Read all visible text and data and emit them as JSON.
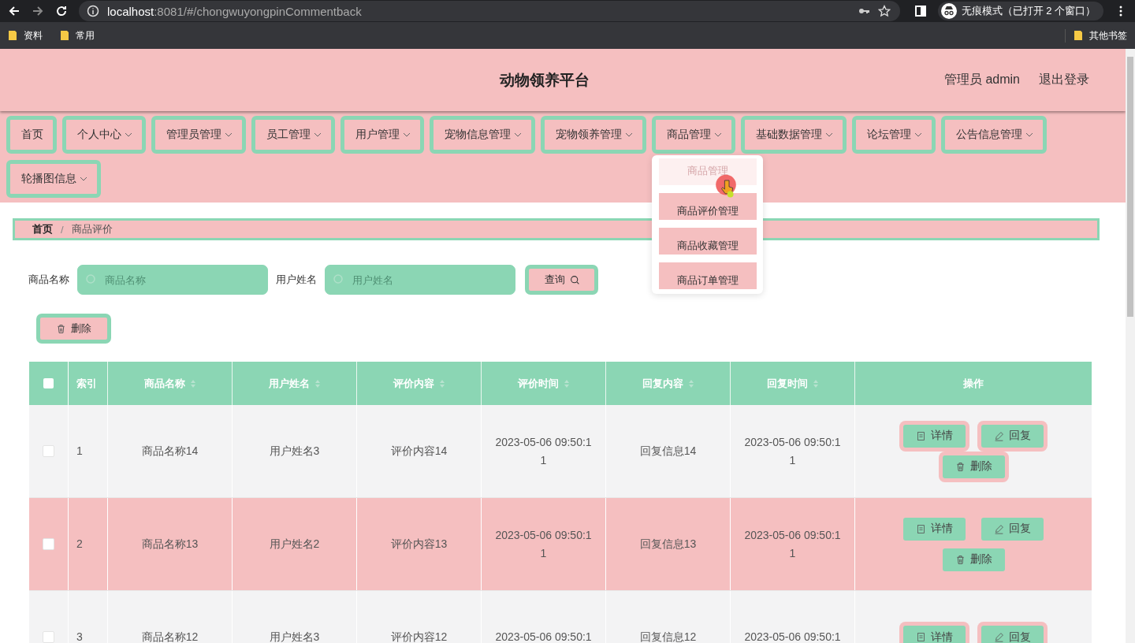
{
  "browser": {
    "url_host": "localhost",
    "url_rest": ":8081/#/chongwuyongpinCommentback",
    "incognito": "无痕模式（已打开 2 个窗口）",
    "bookmarks": [
      "资料",
      "常用"
    ],
    "other_bookmarks": "其他书签"
  },
  "header": {
    "title": "动物领养平台",
    "user": "管理员 admin",
    "logout": "退出登录"
  },
  "nav": [
    {
      "label": "首页",
      "has_menu": false
    },
    {
      "label": "个人中心",
      "has_menu": true
    },
    {
      "label": "管理员管理",
      "has_menu": true
    },
    {
      "label": "员工管理",
      "has_menu": true
    },
    {
      "label": "用户管理",
      "has_menu": true
    },
    {
      "label": "宠物信息管理",
      "has_menu": true
    },
    {
      "label": "宠物领养管理",
      "has_menu": true
    },
    {
      "label": "商品管理",
      "has_menu": true,
      "expanded": true,
      "menu": [
        {
          "label": "商品管理",
          "dimmed": true
        },
        {
          "label": "商品评价管理",
          "dimmed": false
        },
        {
          "label": "商品收藏管理",
          "dimmed": false
        },
        {
          "label": "商品订单管理",
          "dimmed": false
        }
      ]
    },
    {
      "label": "基础数据管理",
      "has_menu": true
    },
    {
      "label": "论坛管理",
      "has_menu": true
    },
    {
      "label": "公告信息管理",
      "has_menu": true
    },
    {
      "label": "轮播图信息",
      "has_menu": true
    }
  ],
  "breadcrumb": [
    "首页",
    "商品评价"
  ],
  "breadcrumb_separator": "/",
  "search": {
    "fields": [
      {
        "label": "商品名称",
        "placeholder": "商品名称"
      },
      {
        "label": "用户姓名",
        "placeholder": "用户姓名"
      }
    ],
    "button": "查询"
  },
  "toolbar": {
    "delete": "删除"
  },
  "table": {
    "header_checked": false,
    "columns": [
      {
        "label": "索引",
        "sortable": false
      },
      {
        "label": "商品名称",
        "sortable": true
      },
      {
        "label": "用户姓名",
        "sortable": true
      },
      {
        "label": "评价内容",
        "sortable": true
      },
      {
        "label": "评价时间",
        "sortable": true
      },
      {
        "label": "回复内容",
        "sortable": true
      },
      {
        "label": "回复时间",
        "sortable": true
      },
      {
        "label": "操作",
        "sortable": false
      }
    ],
    "rows": [
      {
        "checked": false,
        "highlighted": false,
        "cells": [
          "1",
          "商品名称14",
          "用户姓名3",
          "评价内容14",
          "2023-05-06 09:50:11",
          "回复信息14",
          "2023-05-06 09:50:11"
        ],
        "actions": [
          {
            "kind": "detail",
            "label": "详情"
          },
          {
            "kind": "reply",
            "label": "回复"
          },
          {
            "kind": "delete",
            "label": "删除"
          }
        ]
      },
      {
        "checked": false,
        "highlighted": true,
        "cells": [
          "2",
          "商品名称13",
          "用户姓名2",
          "评价内容13",
          "2023-05-06 09:50:11",
          "回复信息13",
          "2023-05-06 09:50:11"
        ],
        "actions": [
          {
            "kind": "detail",
            "label": "详情"
          },
          {
            "kind": "reply",
            "label": "回复"
          },
          {
            "kind": "delete",
            "label": "删除"
          }
        ]
      },
      {
        "checked": false,
        "highlighted": false,
        "cells": [
          "3",
          "商品名称12",
          "用户姓名3",
          "评价内容12",
          "2023-05-06 09:50:1",
          "回复信息12",
          "2023-05-06 09:50:1"
        ],
        "actions": [
          {
            "kind": "detail",
            "label": "详情"
          },
          {
            "kind": "reply",
            "label": "回复"
          }
        ]
      }
    ]
  }
}
